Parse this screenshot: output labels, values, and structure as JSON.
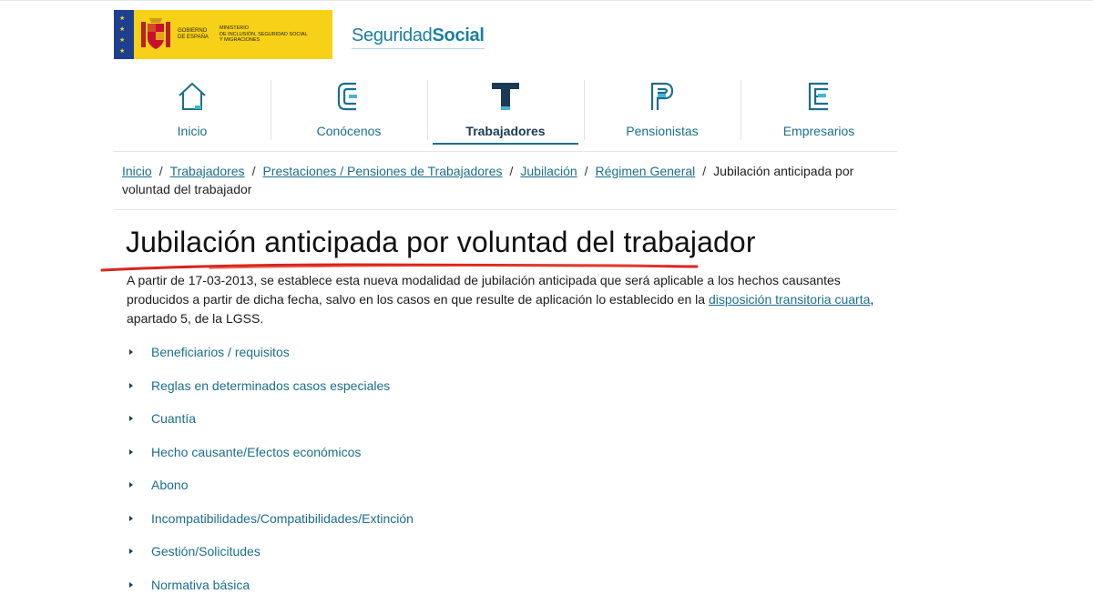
{
  "header": {
    "gov_line1": "GOBIERNO",
    "gov_line2": "DE ESPAÑA",
    "ministry_line1": "MINISTERIO",
    "ministry_line2": "DE INCLUSIÓN, SEGURIDAD SOCIAL",
    "ministry_line3": "Y MIGRACIONES",
    "brand_light": "Seguridad",
    "brand_bold": "Social",
    "colors": {
      "gov_yellow": "#f7d117",
      "eu_blue": "#1d3f8f",
      "brand_teal": "#1b7fa0"
    }
  },
  "nav": {
    "items": [
      {
        "label": "Inicio",
        "icon": "house-icon",
        "active": false
      },
      {
        "label": "Conócenos",
        "icon": "letter-c-icon",
        "active": false
      },
      {
        "label": "Trabajadores",
        "icon": "letter-t-icon",
        "active": true
      },
      {
        "label": "Pensionistas",
        "icon": "letter-p-icon",
        "active": false
      },
      {
        "label": "Empresarios",
        "icon": "letter-e-icon",
        "active": false
      }
    ]
  },
  "breadcrumb": {
    "items": [
      "Inicio",
      "Trabajadores",
      "Prestaciones / Pensiones de Trabajadores",
      "Jubilación",
      "Régimen General"
    ],
    "current": "Jubilación anticipada por voluntad del trabajador",
    "separator": "/"
  },
  "page": {
    "title": "Jubilación anticipada por voluntad del trabajador",
    "intro_before_link": "A partir de 17-03-2013, se establece esta nueva modalidad de jubilación anticipada que será aplicable a los hechos causantes producidos a partir de dicha fecha, salvo en los casos en que resulte de aplicación lo establecido en la ",
    "intro_link": "disposición transitoria cuarta",
    "intro_after_link": ", apartado 5, de la LGSS."
  },
  "sections": [
    "Beneficiarios / requisitos",
    "Reglas en determinados casos especiales",
    "Cuantía",
    "Hecho causante/Efectos económicos",
    "Abono",
    "Incompatibilidades/Compatibilidades/Extinción",
    "Gestión/Solicitudes",
    "Normativa básica"
  ]
}
